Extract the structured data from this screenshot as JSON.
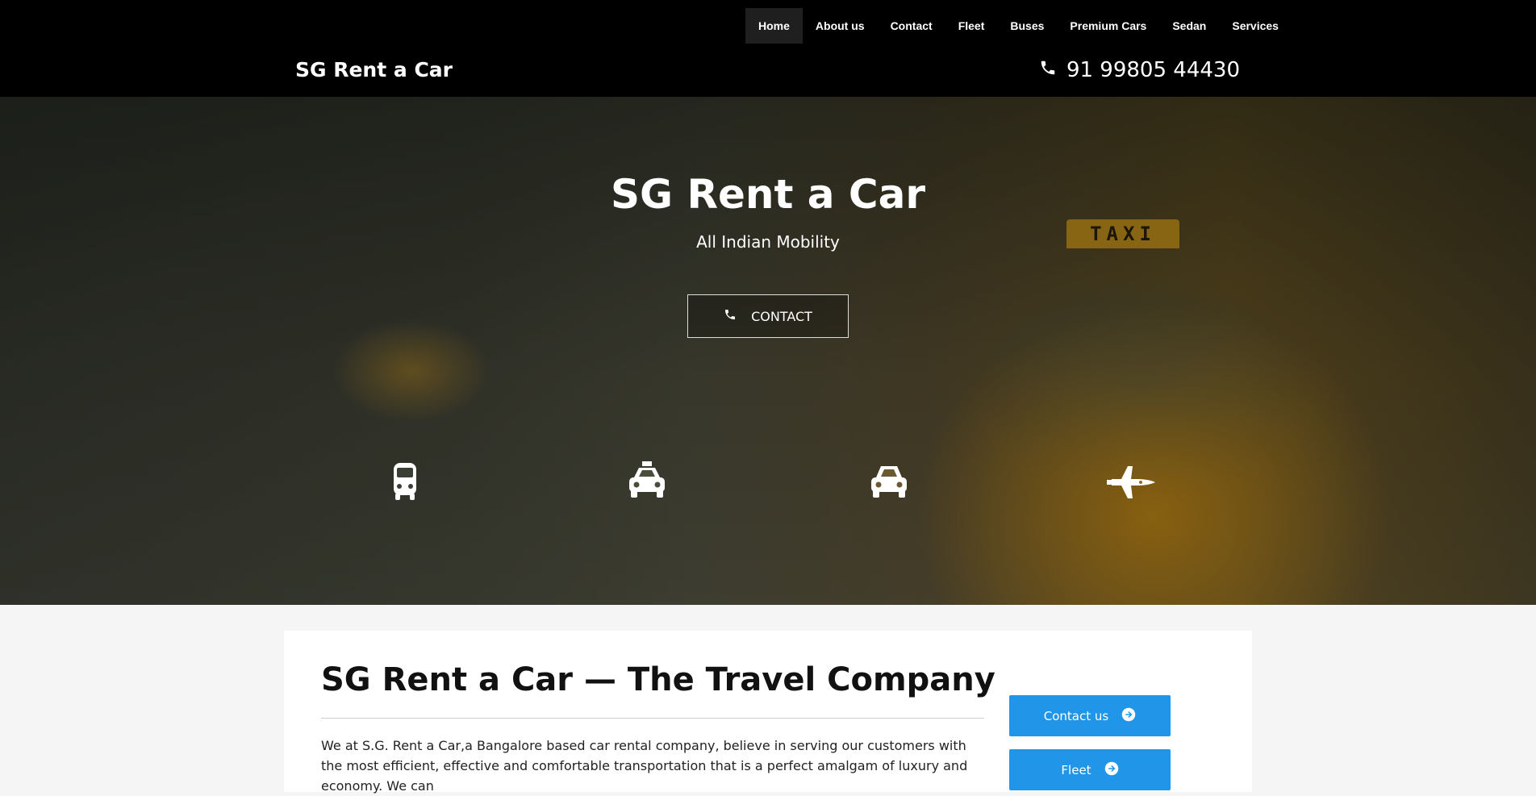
{
  "nav": {
    "items": [
      {
        "label": "Home",
        "active": true
      },
      {
        "label": "About us"
      },
      {
        "label": "Contact"
      },
      {
        "label": "Fleet"
      },
      {
        "label": "Buses"
      },
      {
        "label": "Premium Cars"
      },
      {
        "label": "Sedan"
      },
      {
        "label": "Services"
      }
    ]
  },
  "header": {
    "brand": "SG Rent a Car",
    "phone": "91 99805 44430",
    "phone_icon": "phone-icon"
  },
  "hero": {
    "title": "SG Rent a Car",
    "subtitle": "All Indian Mobility",
    "contact_button": "CONTACT",
    "taxi_sign": "TAXI",
    "icons": [
      "bus-icon",
      "taxi-icon",
      "car-icon",
      "space-shuttle-icon"
    ]
  },
  "content": {
    "title": "SG Rent a Car — The Travel Company",
    "paragraph": "We at S.G. Rent a Car,a Bangalore based car rental company, believe in serving our customers with the most efficient, effective and comfortable transportation that is a perfect amalgam of luxury and economy. We can",
    "buttons": [
      {
        "label": "Contact us",
        "icon": "arrow-circle-right-icon"
      },
      {
        "label": "Fleet",
        "icon": "arrow-circle-right-icon"
      }
    ]
  },
  "colors": {
    "header_bg": "#000000",
    "accent_button": "#2196e8",
    "taxi_yellow": "#c8951c"
  }
}
